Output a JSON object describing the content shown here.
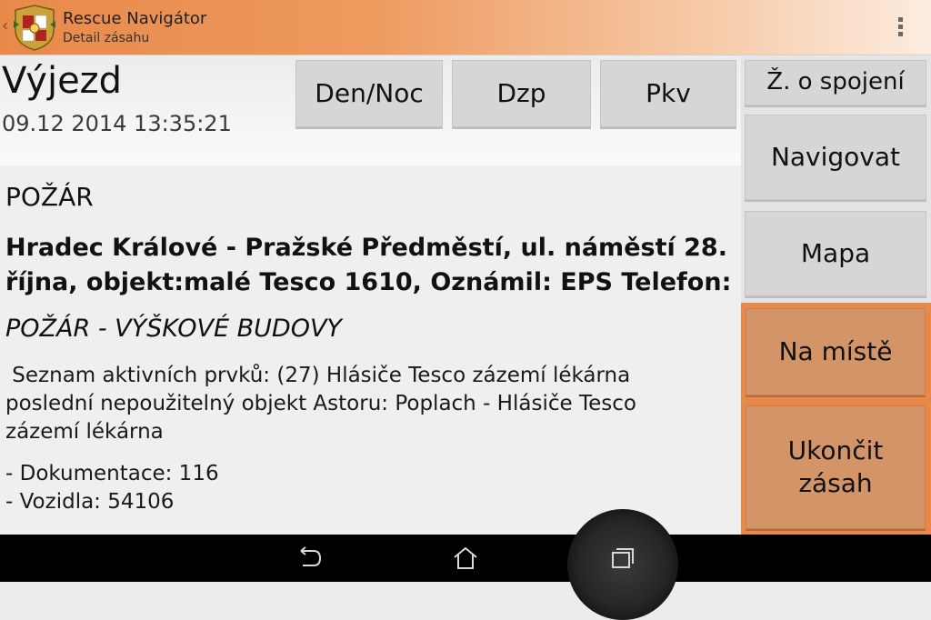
{
  "app": {
    "title": "Rescue Navigátor",
    "subtitle": "Detail zásahu",
    "back_glyph": "‹",
    "logo_icon": "coat-of-arms-icon",
    "menu_icon": "overflow-menu-icon"
  },
  "header": {
    "heading": "Výjezd",
    "datetime": "09.12 2014 13:35:21"
  },
  "toolbar": {
    "day_night_label": "Den/Noc",
    "dzp_label": "Dzp",
    "pkv_label": "Pkv"
  },
  "side_buttons": {
    "connection_request_label": "Ž. o spojení",
    "navigate_label": "Navigovat",
    "map_label": "Mapa",
    "on_site_label": "Na místě",
    "end_line1": "Ukončit",
    "end_line2": "zásah"
  },
  "incident": {
    "category": "POŽÁR",
    "address_line1": "Hradec Králové - Pražské Předměstí, ul. náměstí 28.",
    "address_line2": "října, objekt:malé Tesco 1610, Oznámil: EPS   Telefon:",
    "type": "POŽÁR - VÝŠKOVÉ BUDOVY",
    "description_line1": " Seznam aktivních prvků: (27) Hlásiče Tesco zázemí lékárna",
    "description_line2": "poslední nepoužitelný objekt Astoru: Poplach - Hlásiče Tesco",
    "description_line3": "zázemí lékárna",
    "documentation": "- Dokumentace: 116",
    "vehicles": "- Vozidla: 54106"
  },
  "system_nav": {
    "back_icon": "back-icon",
    "home_icon": "home-icon",
    "recents_icon": "recent-apps-icon"
  },
  "colors": {
    "accent_orange": "#e8894a",
    "orange_button": "#d39468",
    "gray_button": "#d6d6d6"
  }
}
